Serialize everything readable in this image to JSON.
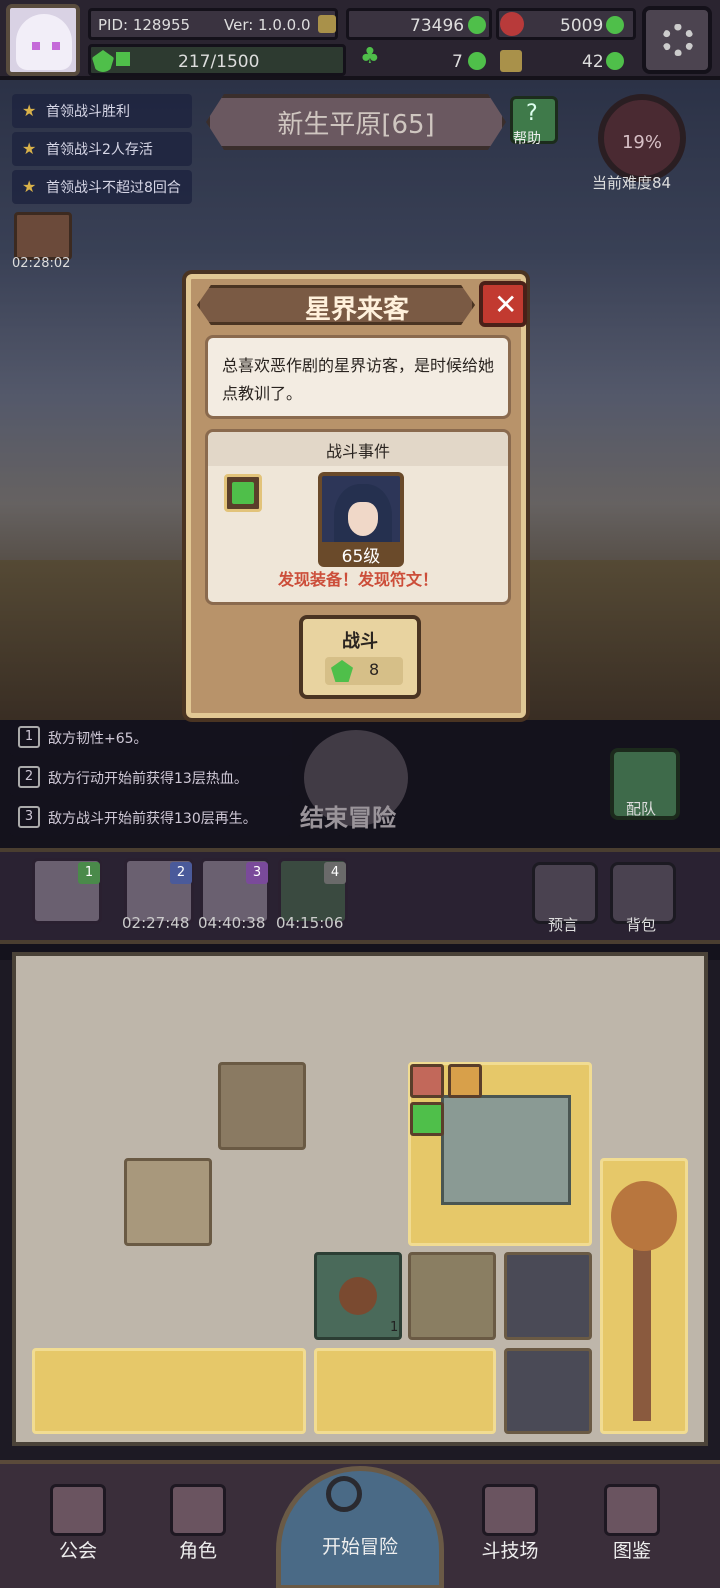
{
  "header": {
    "pid": "PID: 128955",
    "version": "Ver: 1.0.0.0",
    "gold": "73496",
    "gems": "5009",
    "energy": "217/1500",
    "clover": "7",
    "keys": "42"
  },
  "quests": [
    "首领战斗胜利",
    "首领战斗2人存活",
    "首领战斗不超过8回合"
  ],
  "chest_timer": "02:28:02",
  "stage": {
    "title": "新生平原[65]",
    "help": "帮助",
    "difficulty_pct": "19%",
    "difficulty_label": "当前难度84"
  },
  "modal": {
    "title": "星界来客",
    "description": "总喜欢恶作剧的星界访客，是时候给她点教训了。",
    "event_header": "战斗事件",
    "enemy_level": "65级",
    "found": "发现装备！发现符文！",
    "fight_label": "战斗",
    "fight_cost": "8"
  },
  "buffs": [
    {
      "num": "1",
      "text": "敌方韧性+65。"
    },
    {
      "num": "2",
      "text": "敌方行动开始前获得13层热血。"
    },
    {
      "num": "3",
      "text": "敌方战斗开始前获得130层再生。"
    }
  ],
  "end_label": "结束冒险",
  "team_label": "配队",
  "slots": [
    {
      "num": "1",
      "timer": ""
    },
    {
      "num": "2",
      "timer": "02:27:48"
    },
    {
      "num": "3",
      "timer": "04:40:38"
    },
    {
      "num": "4",
      "timer": "04:15:06"
    }
  ],
  "utility": {
    "prophecy": "预言",
    "bag": "背包"
  },
  "grid": {
    "bag_count": "1"
  },
  "nav": {
    "guild": "公会",
    "character": "角色",
    "start": "开始冒险",
    "arena": "斗技场",
    "codex": "图鉴"
  },
  "colors": {
    "gem_green": "#4fbf4a",
    "close_red": "#c23a30",
    "found_red": "#cc4e3a",
    "tile_gold": "#e6c869"
  }
}
